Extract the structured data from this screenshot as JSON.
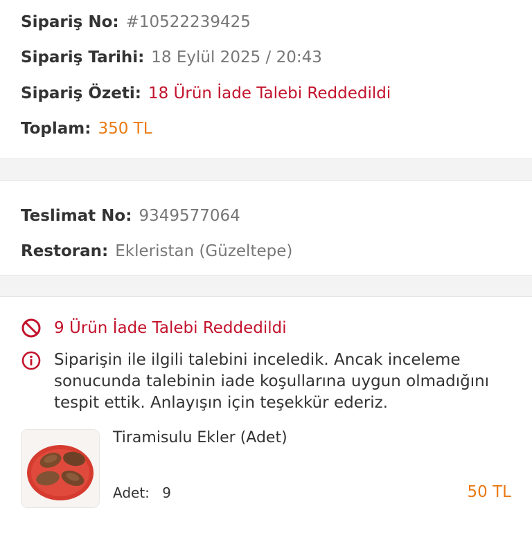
{
  "order": {
    "no_label": "Sipariş No:",
    "no_value": "#10522239425",
    "date_label": "Sipariş Tarihi:",
    "date_value": "18 Eylül 2025 / 20:43",
    "summary_label": "Sipariş Özeti:",
    "summary_value": "18 Ürün İade Talebi Reddedildi",
    "total_label": "Toplam:",
    "total_value": "350 TL"
  },
  "delivery": {
    "no_label": "Teslimat No:",
    "no_value": "9349577064",
    "restaurant_label": "Restoran:",
    "restaurant_value": "Ekleristan (Güzeltepe)"
  },
  "refund": {
    "status_icon": "prohibited-icon",
    "status_text": "9 Ürün İade Talebi Reddedildi",
    "info_icon": "info-icon",
    "info_text": "Siparişin ile ilgili talebini inceledik. Ancak inceleme sonucunda talebinin iade koşullarına uygun olmadığını tespit ettik. Anlayışın için teşekkür ederiz."
  },
  "product": {
    "name": "Tiramisulu Ekler (Adet)",
    "qty_label": "Adet:",
    "qty_value": "9",
    "price": "50 TL"
  },
  "colors": {
    "red": "#c3122c",
    "orange": "#ea7a14",
    "text": "#333333",
    "muted": "#777777"
  }
}
